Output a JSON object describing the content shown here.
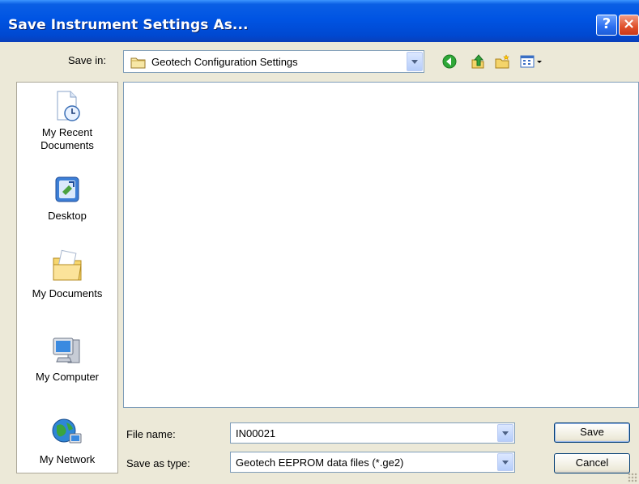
{
  "window": {
    "title": "Save Instrument Settings As...",
    "help_label": "?",
    "close_label": "×"
  },
  "save_in": {
    "label": "Save in:",
    "value": "Geotech Configuration Settings"
  },
  "toolbar": {
    "icons": [
      "back-icon",
      "up-one-level-icon",
      "new-folder-icon",
      "view-menu-icon"
    ]
  },
  "places": [
    {
      "label": "My Recent Documents",
      "icon": "recent-documents-icon"
    },
    {
      "label": "Desktop",
      "icon": "desktop-icon"
    },
    {
      "label": "My Documents",
      "icon": "my-documents-icon"
    },
    {
      "label": "My Computer",
      "icon": "my-computer-icon"
    },
    {
      "label": "My Network",
      "icon": "my-network-icon"
    }
  ],
  "file_name": {
    "label": "File name:",
    "value": "IN00021"
  },
  "save_as_type": {
    "label": "Save as type:",
    "value": "Geotech EEPROM data files (*.ge2)"
  },
  "buttons": {
    "save": "Save",
    "cancel": "Cancel"
  },
  "colors": {
    "title_bar": "#0054e3",
    "dialog_bg": "#ece9d8",
    "border": "#7f9db9"
  }
}
